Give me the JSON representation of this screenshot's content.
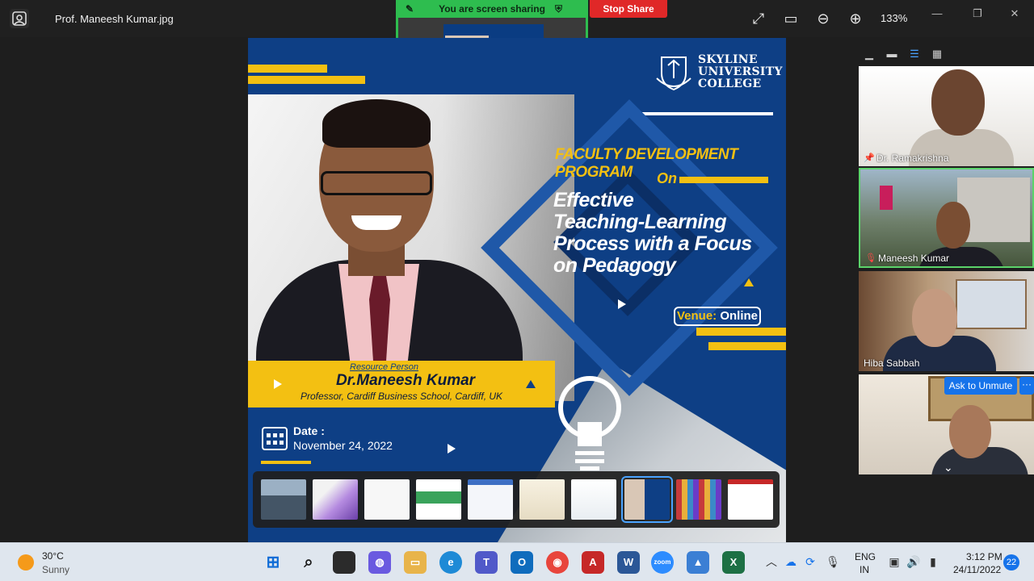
{
  "window": {
    "filename": "Prof. Maneesh Kumar.jpg",
    "zoom_level": "133%"
  },
  "screen_share": {
    "banner": "You are screen sharing",
    "stop_label": "Stop Share",
    "colors": {
      "banner": "#2ebd4f",
      "stop": "#e02828"
    }
  },
  "poster": {
    "logo_line1": "SKYLINE",
    "logo_line2": "UNIVERSITY",
    "logo_line3": "COLLEGE",
    "program": "FACULTY DEVELOPMENT PROGRAM",
    "on": "On",
    "title_line1": "Effective",
    "title_line2": "Teaching-Learning",
    "title_line3": "Process with a Focus",
    "title_line4": "on Pedagogy",
    "venue_label": "Venue:",
    "venue_value": "Online",
    "resource_label": "Resource Person",
    "resource_name": "Dr.Maneesh Kumar",
    "resource_role": "Professor, Cardiff Business School, Cardiff, UK",
    "date_label": "Date :",
    "date_value": "November 24, 2022",
    "colors": {
      "navy": "#0e3f85",
      "gold": "#f3c012"
    }
  },
  "filmstrip": {
    "selected_index": 7,
    "thumbnails": [
      "group-photo-thumb",
      "supply-chain-flyer-thumb",
      "letter-thumb",
      "event-banner-thumb",
      "document-thumb",
      "certificate-thumb",
      "certificate-thumb-2",
      "fdp-poster-thumb",
      "color-chart-thumb",
      "webpage-thumb"
    ]
  },
  "participants": [
    {
      "name": "Dr. Ramakrishna",
      "status_icon": "pin-icon"
    },
    {
      "name": "Maneesh Kumar",
      "status_icon": "mic-off-icon",
      "active_speaker": true
    },
    {
      "name": "Hiba Sabbah"
    },
    {
      "name": ""
    }
  ],
  "participant_panel": {
    "ask_to_unmute": "Ask to Unmute",
    "more": "···"
  },
  "taskbar": {
    "weather_temp": "30°C",
    "weather_condition": "Sunny",
    "lang_line1": "ENG",
    "lang_line2": "IN",
    "time": "3:12 PM",
    "date": "24/11/2022",
    "notification_count": "22",
    "zoom_app_label": "zoom"
  }
}
